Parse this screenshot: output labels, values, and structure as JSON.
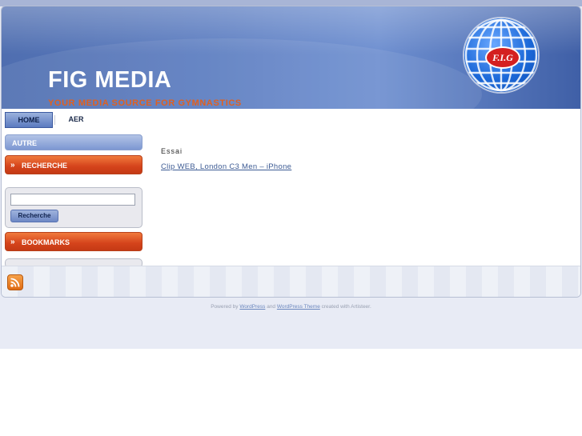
{
  "header": {
    "title": "FIG MEDIA",
    "slogan": "YOUR MEDIA SOURCE FOR GYMNASTICS",
    "logo_text": "F.I.G"
  },
  "nav": {
    "items": [
      {
        "label": "HOME",
        "active": true
      },
      {
        "label": "AER",
        "active": false
      }
    ]
  },
  "sidebar": {
    "autre_label": "AUTRE",
    "search_header": "RECHERCHE",
    "search_placeholder": "",
    "search_button": "Recherche",
    "bookmarks_header": "BOOKMARKS"
  },
  "content": {
    "category_title": "Essai",
    "post_link": "Clip WEB, London C3 Men – iPhone"
  },
  "footer": {
    "powered_prefix": "Powered by",
    "wordpress_link": "WordPress",
    "and_text": "and",
    "theme_link": "WordPress Theme",
    "suffix": "created with Artisteer."
  },
  "colors": {
    "header_blue": "#5b7cc0",
    "orange_accent": "#d5431b",
    "link_blue": "#3d5b94"
  },
  "icons": [
    "rss-icon",
    "chevron-double-right-icon",
    "globe-logo"
  ]
}
